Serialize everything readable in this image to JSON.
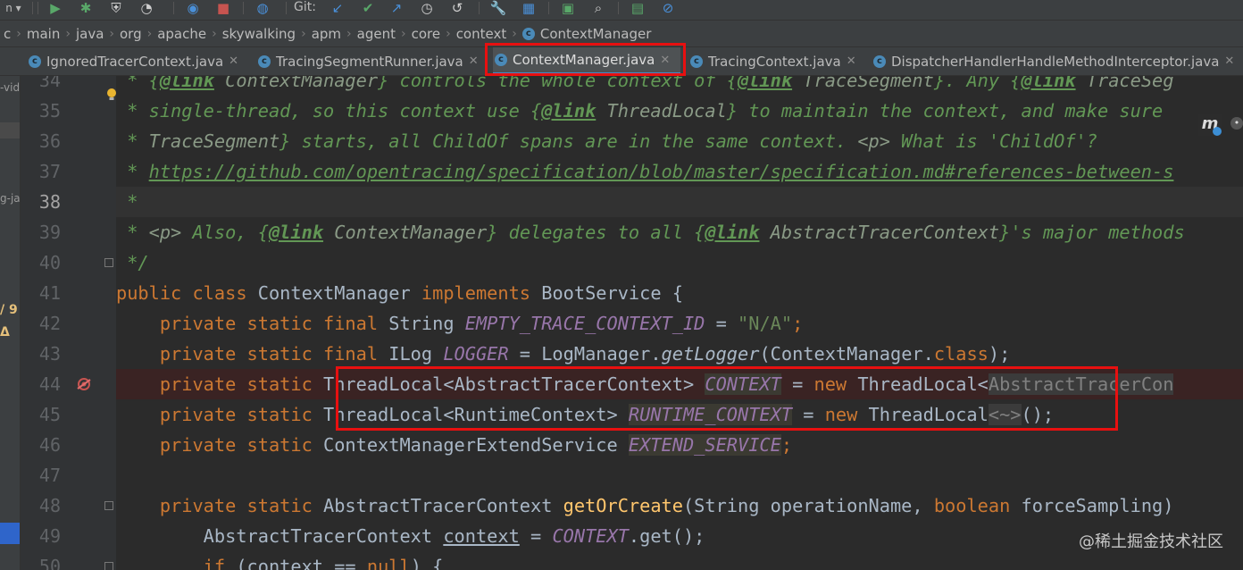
{
  "toolbar": {
    "git_label": "Git:",
    "icons": [
      {
        "name": "run-icon",
        "glyph": "▶",
        "color": "#59a869"
      },
      {
        "name": "debug-icon",
        "glyph": "✱",
        "color": "#59a869"
      },
      {
        "name": "coverage-icon",
        "glyph": "⛨",
        "color": "#cfcfcf"
      },
      {
        "name": "profile-icon",
        "glyph": "◔",
        "color": "#cfcfcf"
      },
      {
        "name": "attach-icon",
        "glyph": "◉",
        "color": "#4a90d9"
      },
      {
        "name": "stop-icon",
        "glyph": "■",
        "color": "#c75450"
      },
      {
        "name": "sdk-icon",
        "glyph": "◍",
        "color": "#4a90d9"
      },
      {
        "name": "git-update-icon",
        "glyph": "↙",
        "color": "#4a90d9"
      },
      {
        "name": "git-commit-icon",
        "glyph": "✔",
        "color": "#59a869"
      },
      {
        "name": "git-push-icon",
        "glyph": "↗",
        "color": "#4a90d9"
      },
      {
        "name": "history-icon",
        "glyph": "◷",
        "color": "#cfcfcf"
      },
      {
        "name": "rollback-icon",
        "glyph": "↺",
        "color": "#cfcfcf"
      },
      {
        "name": "wrench-icon",
        "glyph": "🔧",
        "color": "#cfcfcf"
      },
      {
        "name": "project-structure-icon",
        "glyph": "▦",
        "color": "#4a90d9"
      },
      {
        "name": "terminal-icon",
        "glyph": "▣",
        "color": "#59a869"
      },
      {
        "name": "search-icon",
        "glyph": "⌕",
        "color": "#cfcfcf"
      },
      {
        "name": "chart-icon",
        "glyph": "▤",
        "color": "#59a869"
      },
      {
        "name": "no-entry-icon",
        "glyph": "⊘",
        "color": "#4a90d9"
      }
    ]
  },
  "breadcrumb": {
    "items": [
      "c",
      "main",
      "java",
      "org",
      "apache",
      "skywalking",
      "apm",
      "agent",
      "core",
      "context"
    ],
    "file": "ContextManager"
  },
  "tabs": [
    {
      "label": "IgnoredTracerContext.java"
    },
    {
      "label": "TracingSegmentRunner.java"
    },
    {
      "label": "ContextManager.java"
    },
    {
      "label": "TracingContext.java"
    },
    {
      "label": "DispatcherHandlerHandleMethodInterceptor.java"
    }
  ],
  "sidebar": {
    "frag1": "-vid",
    "frag2": "g-ja",
    "frag3": "/ 9",
    "frag4": "Δ"
  },
  "gutter": {
    "lines": [
      "34",
      "35",
      "36",
      "37",
      "38",
      "39",
      "40",
      "41",
      "42",
      "43",
      "44",
      "45",
      "46",
      "47",
      "48",
      "49",
      "50"
    ]
  },
  "code": {
    "l34": [
      {
        "t": " * {",
        "c": "doc"
      },
      {
        "t": "@link",
        "c": "tag"
      },
      {
        "t": " ContextManager",
        "c": "ref"
      },
      {
        "t": "} controls the whole context of {",
        "c": "doc"
      },
      {
        "t": "@link",
        "c": "tag"
      },
      {
        "t": " TraceSegment",
        "c": "ref"
      },
      {
        "t": "}. Any {",
        "c": "doc"
      },
      {
        "t": "@link",
        "c": "tag"
      },
      {
        "t": " TraceSeg",
        "c": "ref"
      }
    ],
    "l35": [
      {
        "t": " * single-thread, so this context use {",
        "c": "doc"
      },
      {
        "t": "@link",
        "c": "tag"
      },
      {
        "t": " ThreadLocal",
        "c": "ref"
      },
      {
        "t": "} to maintain the context, and make sure",
        "c": "doc"
      }
    ],
    "l36": [
      {
        "t": " * ",
        "c": "doc"
      },
      {
        "t": "TraceSegment",
        "c": "ref"
      },
      {
        "t": "} starts, all ChildOf spans are in the same context. ",
        "c": "doc"
      },
      {
        "t": "<p>",
        "c": "ref"
      },
      {
        "t": " What is 'ChildOf'?",
        "c": "doc"
      }
    ],
    "l37": [
      {
        "t": " * ",
        "c": "doc"
      },
      {
        "t": "https://github.com/opentracing/specification/blob/master/specification.md#references-between-s",
        "c": "url"
      }
    ],
    "l38": [
      {
        "t": " *",
        "c": "doc"
      }
    ],
    "l39": [
      {
        "t": " * ",
        "c": "doc"
      },
      {
        "t": "<p>",
        "c": "ref"
      },
      {
        "t": " Also, {",
        "c": "doc"
      },
      {
        "t": "@link",
        "c": "tag"
      },
      {
        "t": " ContextManager",
        "c": "ref"
      },
      {
        "t": "} delegates to all {",
        "c": "doc"
      },
      {
        "t": "@link",
        "c": "tag"
      },
      {
        "t": " AbstractTracerContext",
        "c": "ref"
      },
      {
        "t": "}'s major methods",
        "c": "doc"
      }
    ],
    "l40": [
      {
        "t": " */",
        "c": "doc"
      }
    ],
    "l41": [
      {
        "t": "public class ",
        "c": "kw"
      },
      {
        "t": "ContextManager ",
        "c": ""
      },
      {
        "t": "implements ",
        "c": "kw"
      },
      {
        "t": "BootService {",
        "c": ""
      }
    ],
    "l42": [
      {
        "t": "    private static final ",
        "c": "kw"
      },
      {
        "t": "String ",
        "c": ""
      },
      {
        "t": "EMPTY_TRACE_CONTEXT_ID",
        "c": "field"
      },
      {
        "t": " = ",
        "c": ""
      },
      {
        "t": "\"N/A\"",
        "c": "str"
      },
      {
        "t": ";",
        "c": "kw"
      }
    ],
    "l43": [
      {
        "t": "    private static final ",
        "c": "kw"
      },
      {
        "t": "ILog ",
        "c": ""
      },
      {
        "t": "LOGGER",
        "c": "field"
      },
      {
        "t": " = LogManager.",
        "c": ""
      },
      {
        "t": "getLogger",
        "c": "methodi"
      },
      {
        "t": "(ContextManager.",
        "c": ""
      },
      {
        "t": "class",
        "c": "kw"
      },
      {
        "t": ");",
        "c": ""
      }
    ],
    "l44": [
      {
        "t": "    private static ",
        "c": "kw"
      },
      {
        "t": "ThreadLocal<AbstractTracerContext> ",
        "c": ""
      },
      {
        "t": "CONTEXT",
        "c": "field-hl"
      },
      {
        "t": " = ",
        "c": ""
      },
      {
        "t": "new ",
        "c": "kw"
      },
      {
        "t": "ThreadLocal<",
        "c": ""
      },
      {
        "t": "AbstractTracerCon",
        "c": "fold-grey"
      }
    ],
    "l45": [
      {
        "t": "    private static ",
        "c": "kw"
      },
      {
        "t": "ThreadLocal<RuntimeContext> ",
        "c": ""
      },
      {
        "t": "RUNTIME_CONTEXT",
        "c": "field-hl"
      },
      {
        "t": " = ",
        "c": ""
      },
      {
        "t": "new ",
        "c": "kw"
      },
      {
        "t": "ThreadLocal",
        "c": ""
      },
      {
        "t": "<~>",
        "c": "fold-grey"
      },
      {
        "t": "();",
        "c": ""
      }
    ],
    "l46": [
      {
        "t": "    private static ",
        "c": "kw"
      },
      {
        "t": "ContextManagerExtendService ",
        "c": ""
      },
      {
        "t": "EXTEND_SERVICE",
        "c": "field-hl"
      },
      {
        "t": ";",
        "c": "kw"
      }
    ],
    "l47": [
      {
        "t": "",
        "c": ""
      }
    ],
    "l48": [
      {
        "t": "    private static ",
        "c": "kw"
      },
      {
        "t": "AbstractTracerContext ",
        "c": ""
      },
      {
        "t": "getOrCreate",
        "c": "method"
      },
      {
        "t": "(String operationName, ",
        "c": ""
      },
      {
        "t": "boolean ",
        "c": "kw"
      },
      {
        "t": "forceSampling)",
        "c": ""
      }
    ],
    "l49": [
      {
        "t": "        AbstractTracerContext ",
        "c": ""
      },
      {
        "t": "context",
        "c": "under"
      },
      {
        "t": " = ",
        "c": ""
      },
      {
        "t": "CONTEXT",
        "c": "field"
      },
      {
        "t": ".get();",
        "c": ""
      }
    ],
    "l50": [
      {
        "t": "        if ",
        "c": "kw"
      },
      {
        "t": "(context == ",
        "c": ""
      },
      {
        "t": "null",
        "c": "kw"
      },
      {
        "t": ") {",
        "c": ""
      }
    ]
  },
  "plugin_badge": "m",
  "watermark": "@稀土掘金技术社区",
  "colors": {
    "highlight_box": "#e81010",
    "tab_underline": "#4a88c7",
    "background": "#2b2b2b"
  }
}
